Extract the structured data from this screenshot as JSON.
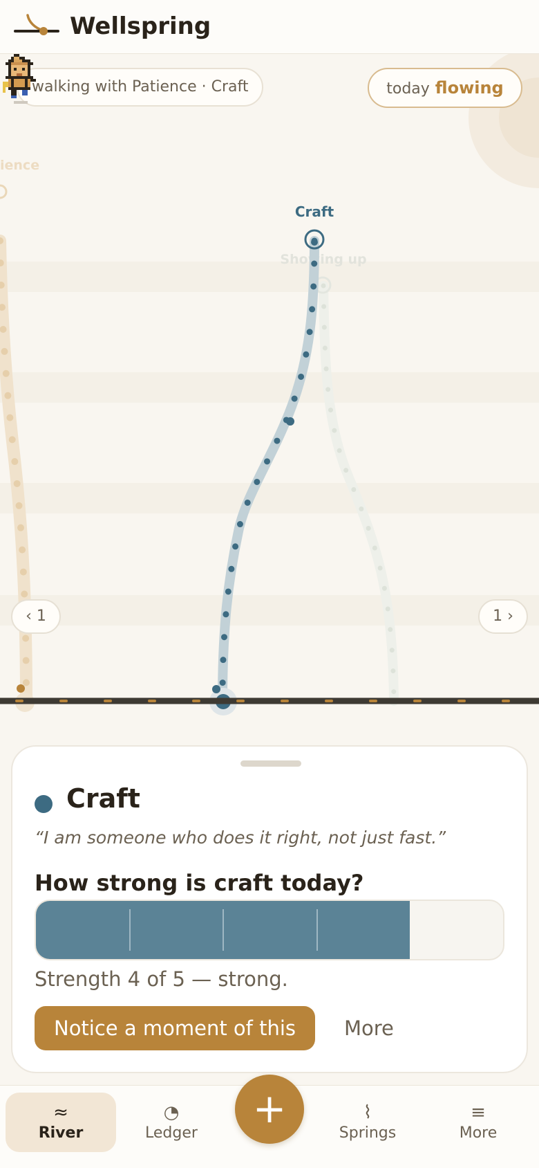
{
  "app": {
    "title": "Wellspring"
  },
  "river": {
    "context_label": "walking with Patience · Craft",
    "today": {
      "label": "today",
      "value": "flowing"
    },
    "streams": [
      {
        "name": "Patience",
        "color": "#e6cfa8",
        "state": "faded"
      },
      {
        "name": "Craft",
        "color": "#3d6b82",
        "state": "selected"
      },
      {
        "name": "Showing up",
        "color": "#dfe3dc",
        "state": "faded"
      }
    ],
    "nav_prev": "‹ 1",
    "nav_next": "1 ›",
    "walker_icon": "pixel-walker-avatar"
  },
  "card": {
    "stream_name": "Craft",
    "stream_color": "#3d6b82",
    "quote": "“I am someone who does it right, not just fast.”",
    "question": "How strong is craft today?",
    "strength": {
      "value": 4,
      "max": 5
    },
    "strength_text": "Strength 4 of 5 — strong.",
    "primary_action": "Notice a moment of this",
    "secondary_action": "More"
  },
  "tabbar": {
    "tabs": [
      {
        "label": "River",
        "icon": "≈",
        "icon_name": "river-icon",
        "active": true
      },
      {
        "label": "Ledger",
        "icon": "◔",
        "icon_name": "ledger-icon",
        "active": false
      },
      {
        "label": "Springs",
        "icon": "⌇",
        "icon_name": "springs-icon",
        "active": false
      },
      {
        "label": "More",
        "icon": "≡",
        "icon_name": "menu-icon",
        "active": false
      }
    ],
    "add_icon": "+"
  },
  "colors": {
    "accent": "#b8843a",
    "craft": "#3d6b82",
    "craft_meter": "#5b8396",
    "background": "#f9f6f0"
  }
}
